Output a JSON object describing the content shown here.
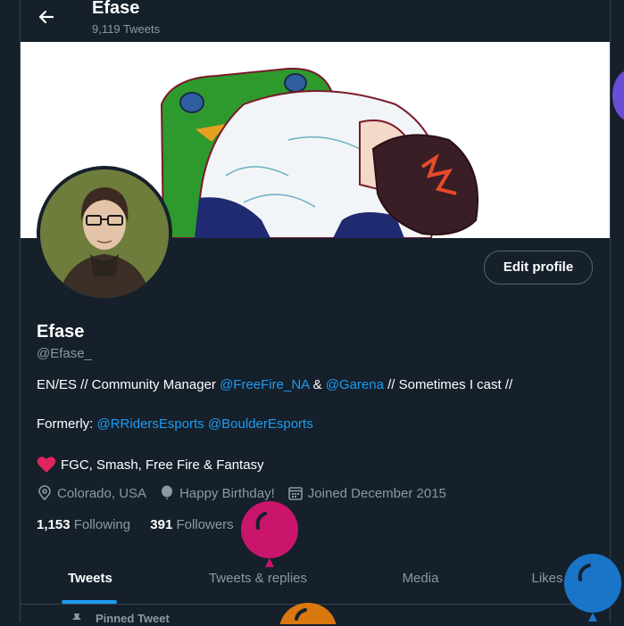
{
  "header": {
    "title": "Efase",
    "tweet_count": "9,119 Tweets"
  },
  "profile": {
    "display_name": "Efase",
    "handle": "@Efase_",
    "edit_label": "Edit profile",
    "bio": {
      "line1_a": "EN/ES // Community Manager ",
      "line1_link1": "@FreeFire_NA",
      "line1_b": " & ",
      "line1_link2": "@Garena",
      "line1_c": " // Sometimes I cast //",
      "line2_a": "Formerly: ",
      "line2_link1": "@RRidersEsports",
      "line2_link2": "@BoulderEsports",
      "line3": "FGC, Smash, Free Fire & Fantasy"
    },
    "location": "Colorado, USA",
    "birthday": "Happy Birthday!",
    "joined": "Joined December 2015",
    "following_count": "1,153",
    "following_label": "Following",
    "followers_count": "391",
    "followers_label": "Followers"
  },
  "tabs": [
    {
      "label": "Tweets"
    },
    {
      "label": "Tweets & replies"
    },
    {
      "label": "Media"
    },
    {
      "label": "Likes"
    }
  ],
  "pinned_label": "Pinned Tweet",
  "colors": {
    "background": "#15202b",
    "accent": "#1d9bf0",
    "muted": "#8b98a5",
    "heart": "#f91880"
  },
  "icons": [
    "back-arrow-icon",
    "location-icon",
    "balloon-icon",
    "calendar-icon",
    "heart-icon",
    "pin-icon"
  ]
}
